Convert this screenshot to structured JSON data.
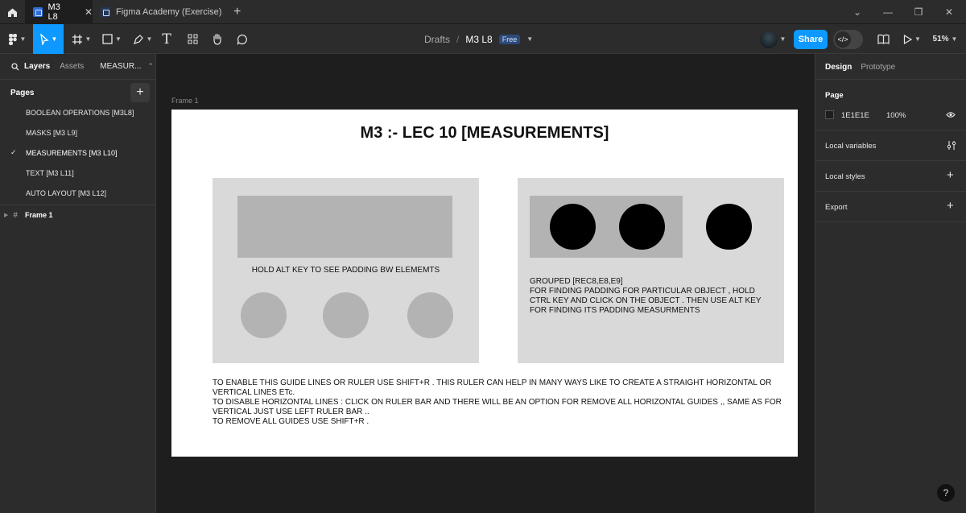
{
  "tabs": [
    {
      "label": "M3 L8",
      "active": true
    },
    {
      "label": "Figma Academy (Exercise)",
      "active": false
    }
  ],
  "breadcrumb": {
    "folder": "Drafts",
    "separator": "/",
    "file": "M3 L8",
    "plan_badge": "Free"
  },
  "toolbar": {
    "share_label": "Share",
    "zoom": "51%"
  },
  "left_panel": {
    "tabs": [
      "Layers",
      "Assets"
    ],
    "page_dropdown": "MEASUR...",
    "pages_title": "Pages",
    "pages": [
      {
        "label": "BOOLEAN OPERATIONS [M3L8]",
        "current": false
      },
      {
        "label": "MASKS [M3 L9]",
        "current": false
      },
      {
        "label": "MEASUREMENTS [M3 L10]",
        "current": true
      },
      {
        "label": "TEXT [M3 L11]",
        "current": false
      },
      {
        "label": "AUTO LAYOUT [M3 L12]",
        "current": false
      }
    ],
    "layer": "Frame 1"
  },
  "right_panel": {
    "tabs": [
      "Design",
      "Prototype"
    ],
    "page_section": "Page",
    "page_color_hex": "1E1E1E",
    "page_opacity": "100%",
    "sections": [
      "Local variables",
      "Local styles",
      "Export"
    ]
  },
  "canvas": {
    "frame_label": "Frame 1",
    "title": "M3 :- LEC 10 [MEASUREMENTS]",
    "left_caption": "HOLD ALT KEY TO SEE PADDING BW ELEMEMTS",
    "right_caption_lines": [
      "GROUPED [REC8,E8,E9]",
      "FOR FINDING PADDING FOR PARTICULAR OBJECT , HOLD",
      "CTRL KEY AND CLICK ON THE OBJECT . THEN USE ALT KEY",
      "FOR FINDING ITS PADDING MEASURMENTS"
    ],
    "notes": [
      "TO ENABLE THIS GUIDE LINES OR RULER USE SHIFT+R . THIS RULER CAN HELP IN MANY WAYS LIKE TO CREATE A STRAIGHT HORIZONTAL OR",
      "VERTICAL LINES ETc.",
      "TO DISABLE HORIZONTAL LINES : CLICK ON  RULER BAR AND THERE WILL BE AN OPTION FOR REMOVE ALL HORIZONTAL GUIDES ,, SAME AS FOR",
      "VERTICAL JUST USE LEFT RULER BAR ..",
      "TO REMOVE ALL GUIDES USE SHIFT+R ."
    ]
  },
  "help_label": "?",
  "colors": {
    "accent": "#0d99ff",
    "panel": "#2c2c2c",
    "canvas": "#1e1e1e"
  }
}
